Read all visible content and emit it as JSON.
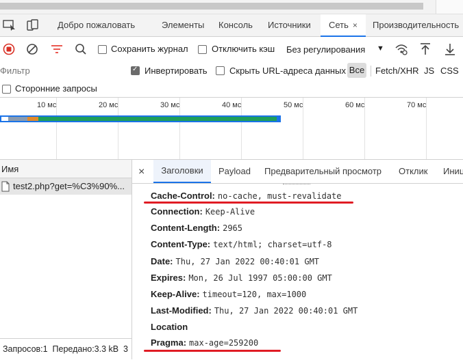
{
  "tabs": [
    {
      "label": "Добро пожаловать"
    },
    {
      "label": "Элементы"
    },
    {
      "label": "Консоль"
    },
    {
      "label": "Источники"
    },
    {
      "label": "Сеть",
      "close": "×"
    },
    {
      "label": "Производительность"
    }
  ],
  "toolbar": {
    "preserve_log": "Сохранить журнал",
    "disable_cache": "Отключить кэш",
    "throttling": "Без регулирования"
  },
  "filter": {
    "placeholder": "Фильтр",
    "invert": "Инвертировать",
    "hide_data_urls": "Скрыть URL-адреса данных",
    "types": [
      "Все",
      "Fetch/XHR",
      "JS",
      "CSS"
    ],
    "third_party": "Сторонние запросы"
  },
  "timeline": {
    "ticks": [
      "10 мс",
      "20 мс",
      "30 мс",
      "40 мс",
      "50 мс",
      "60 мс",
      "70 мс"
    ]
  },
  "requests": {
    "column": "Имя",
    "rows": [
      {
        "name": "test2.php?get=%C3%90%..."
      }
    ],
    "status": "Запросов:1  Передано:3.3 kB  3"
  },
  "details": {
    "close": "×",
    "tabs": [
      "Заголовки",
      "Payload",
      "Предварительный просмотр",
      "Отклик",
      "Иници"
    ],
    "headers": [
      {
        "name": "Cache-Control:",
        "value": "no-cache, must-revalidate"
      },
      {
        "name": "Connection:",
        "value": "Keep-Alive"
      },
      {
        "name": "Content-Length:",
        "value": "2965"
      },
      {
        "name": "Content-Type:",
        "value": "text/html; charset=utf-8"
      },
      {
        "name": "Date:",
        "value": "Thu, 27 Jan 2022 00:40:01 GMT"
      },
      {
        "name": "Expires:",
        "value": "Mon, 26 Jul 1997 05:00:00 GMT"
      },
      {
        "name": "Keep-Alive:",
        "value": "timeout=120, max=1000"
      },
      {
        "name": "Last-Modified:",
        "value": "Thu, 27 Jan 2022 00:40:01 GMT"
      },
      {
        "name": "Location",
        "value": ""
      },
      {
        "name": "Pragma:",
        "value": "max-age=259200"
      }
    ]
  },
  "colors": {
    "accent": "#1a73e8",
    "record": "#d93025",
    "highlight": "#e01b24",
    "waterfall_green": "#1e9e5a"
  }
}
